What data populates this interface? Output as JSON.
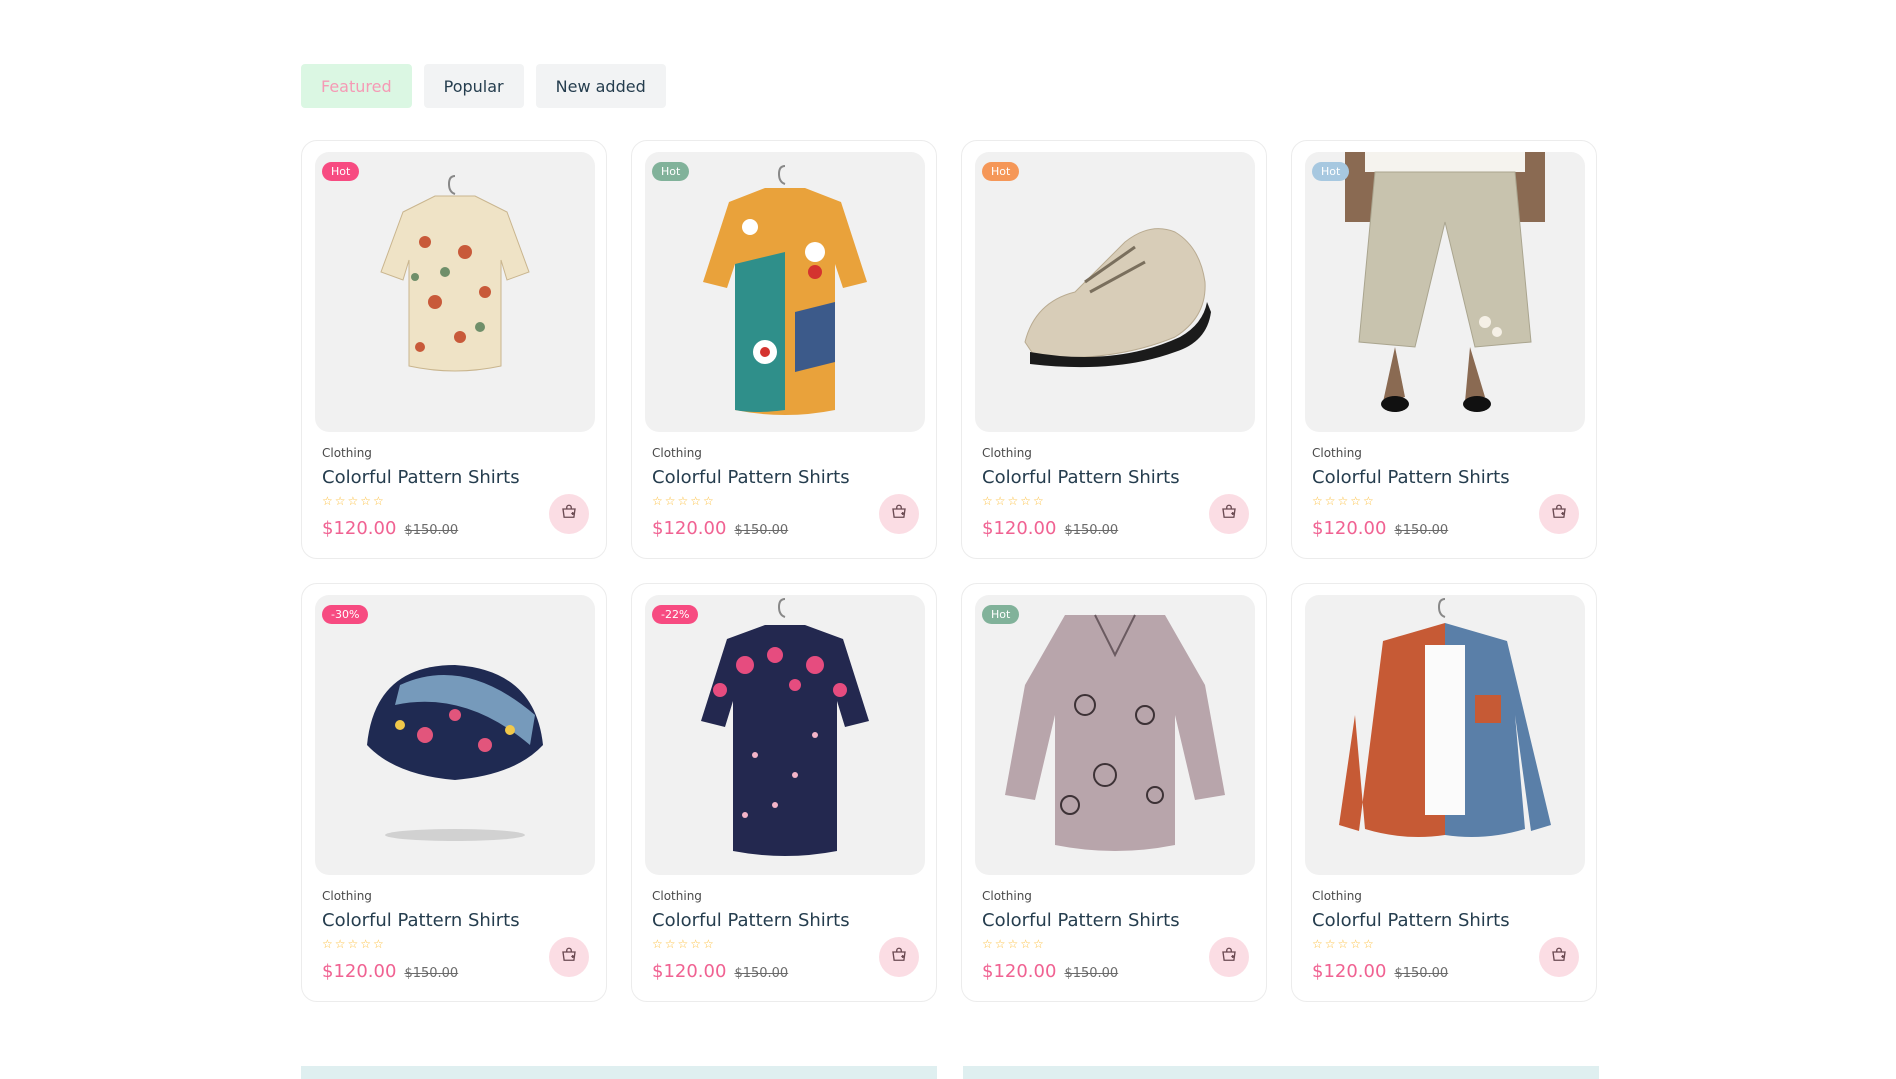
{
  "tabs": [
    {
      "label": "Featured",
      "active": true
    },
    {
      "label": "Popular",
      "active": false
    },
    {
      "label": "New added",
      "active": false
    }
  ],
  "products": [
    {
      "badge": "Hot",
      "badge_color": "#f74b81",
      "category": "Clothing",
      "title": "Colorful Pattern Shirts",
      "rating_stars": "☆☆☆☆☆",
      "price": "$120.00",
      "old_price": "$150.00",
      "image": "mushroom-print-shirt"
    },
    {
      "badge": "Hot",
      "badge_color": "#81b29a",
      "category": "Clothing",
      "title": "Colorful Pattern Shirts",
      "rating_stars": "☆☆☆☆☆",
      "price": "$120.00",
      "old_price": "$150.00",
      "image": "floral-block-shirt"
    },
    {
      "badge": "Hot",
      "badge_color": "#f59758",
      "category": "Clothing",
      "title": "Colorful Pattern Shirts",
      "rating_stars": "☆☆☆☆☆",
      "price": "$120.00",
      "old_price": "$150.00",
      "image": "beige-sneaker"
    },
    {
      "badge": "Hot",
      "badge_color": "#a7c8e0",
      "category": "Clothing",
      "title": "Colorful Pattern Shirts",
      "rating_stars": "☆☆☆☆☆",
      "price": "$120.00",
      "old_price": "$150.00",
      "image": "linen-pants"
    },
    {
      "badge": "-30%",
      "badge_color": "#f74b81",
      "category": "Clothing",
      "title": "Colorful Pattern Shirts",
      "rating_stars": "☆☆☆☆☆",
      "price": "$120.00",
      "old_price": "$150.00",
      "image": "patterned-beanie"
    },
    {
      "badge": "-22%",
      "badge_color": "#f74b81",
      "category": "Clothing",
      "title": "Colorful Pattern Shirts",
      "rating_stars": "☆☆☆☆☆",
      "price": "$120.00",
      "old_price": "$150.00",
      "image": "navy-floral-shirt"
    },
    {
      "badge": "Hot",
      "badge_color": "#81b29a",
      "category": "Clothing",
      "title": "Colorful Pattern Shirts",
      "rating_stars": "☆☆☆☆☆",
      "price": "$120.00",
      "old_price": "$150.00",
      "image": "printed-blouse"
    },
    {
      "badge": "",
      "badge_color": "#81b29a",
      "category": "Clothing",
      "title": "Colorful Pattern Shirts",
      "rating_stars": "☆☆☆☆☆",
      "price": "$120.00",
      "old_price": "$150.00",
      "image": "corduroy-colorblock-shirt"
    }
  ],
  "colors": {
    "accent": "#f06292",
    "active_tab_bg": "#dbf7e3",
    "cart_bg": "#fbdde4"
  },
  "icons": {
    "cart": "cart-icon"
  }
}
